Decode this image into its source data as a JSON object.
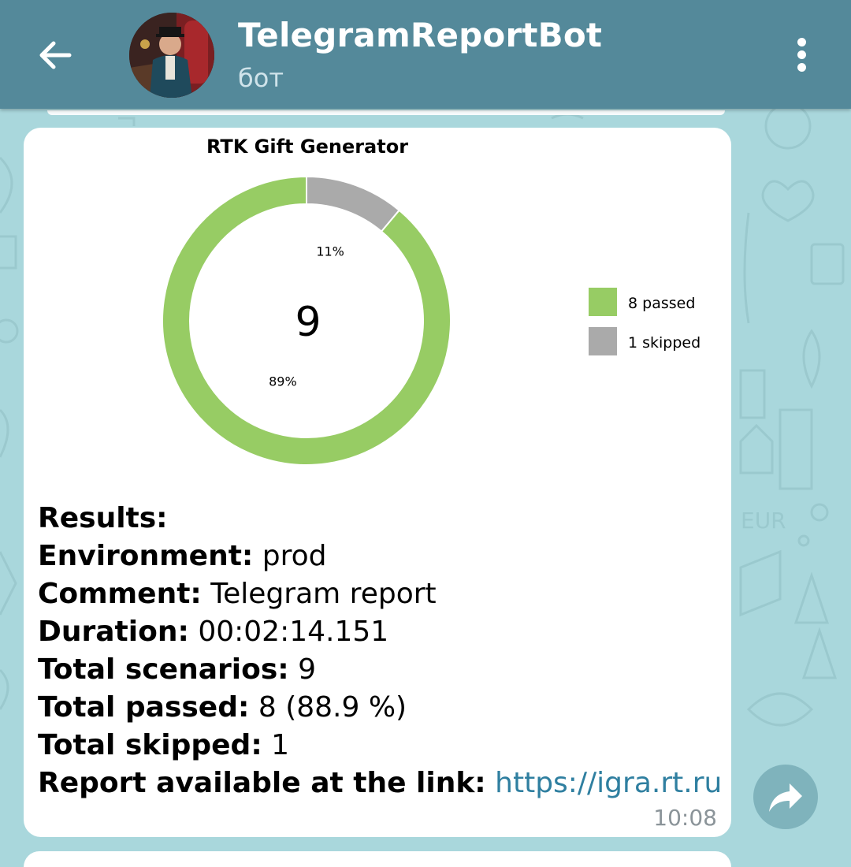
{
  "header": {
    "title": "TelegramReportBot",
    "subtitle": "бот",
    "icons": {
      "back": "arrow-left-icon",
      "menu": "more-vert-icon",
      "avatar": "bot-avatar"
    }
  },
  "message": {
    "chart_data": {
      "type": "pie",
      "title": "RTK Gift Generator",
      "center_label": "9",
      "categories": [
        "8 passed",
        "1 skipped"
      ],
      "values": [
        8,
        1
      ],
      "percent_labels": [
        "89%",
        "11%"
      ],
      "colors": [
        "#97cc64",
        "#aaaaaa"
      ],
      "donut": true,
      "legend_position": "right"
    },
    "lines": [
      {
        "label": "Results:",
        "value": ""
      },
      {
        "label": "Environment:",
        "value": "prod"
      },
      {
        "label": "Comment:",
        "value": "Telegram report"
      },
      {
        "label": "Duration:",
        "value": "00:02:14.151"
      },
      {
        "label": "Total scenarios:",
        "value": "9"
      },
      {
        "label": "Total passed:",
        "value": "8 (88.9 %)"
      },
      {
        "label": "Total skipped:",
        "value": "1"
      },
      {
        "label": "Report available at the link:",
        "value": "https://igra.rt.ru"
      }
    ],
    "time": "10:08",
    "link_color": "#2f7fa0"
  },
  "share_icon": "share-forward-icon"
}
